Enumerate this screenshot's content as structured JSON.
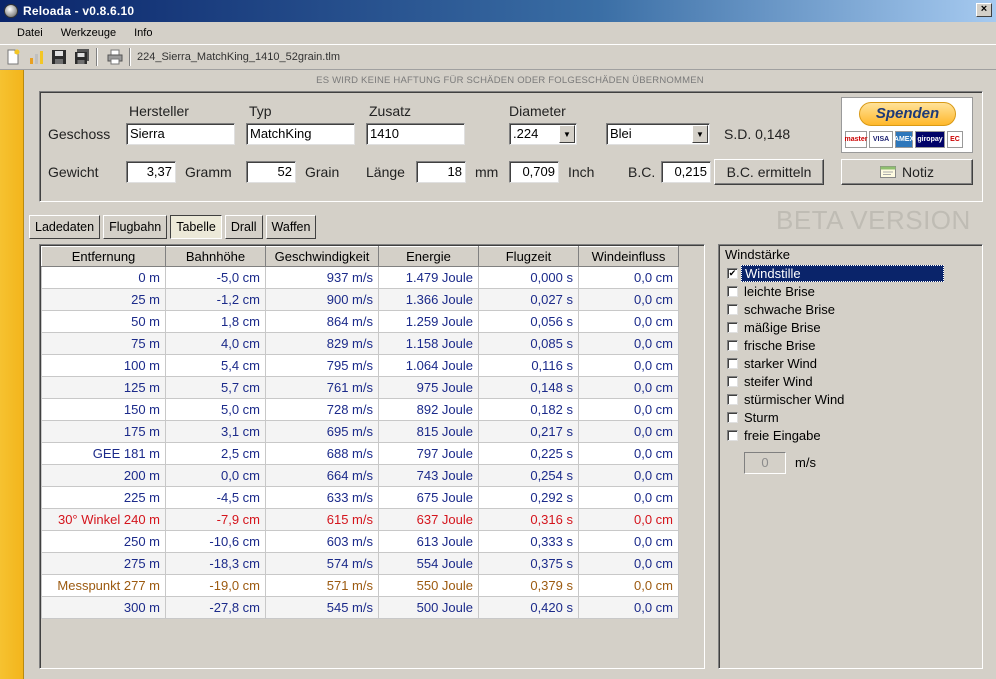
{
  "window": {
    "title": "Reloada - v0.8.6.10",
    "close_label": "×"
  },
  "menu": [
    "Datei",
    "Werkzeuge",
    "Info"
  ],
  "toolbar": {
    "buttons": [
      "new-file-icon",
      "chart-icon",
      "save-icon",
      "save-all-icon",
      "print-icon"
    ],
    "filename": "224_Sierra_MatchKing_1410_52grain.tlm"
  },
  "disclaimer": "ES WIRD KEINE HAFTUNG FÜR SCHÄDEN ODER FOLGESCHÄDEN ÜBERNOMMEN",
  "projectile": {
    "row_label": "Geschoss",
    "headers": {
      "manufacturer": "Hersteller",
      "type": "Typ",
      "suffix": "Zusatz",
      "diameter": "Diameter"
    },
    "manufacturer": "Sierra",
    "type": "MatchKing",
    "suffix": "1410",
    "diameter": ".224",
    "material": "Blei",
    "sd": "S.D. 0,148"
  },
  "weight": {
    "label": "Gewicht",
    "gramm_value": "3,37",
    "gramm_unit": "Gramm",
    "grain_value": "52",
    "grain_unit": "Grain",
    "length_label": "Länge",
    "length_value": "18",
    "length_unit": "mm",
    "inch_value": "0,709",
    "inch_unit": "Inch",
    "bc_label": "B.C.",
    "bc_value": "0,215",
    "bc_button": "B.C. ermitteln",
    "note_button": "Notiz"
  },
  "donate": {
    "label": "Spenden",
    "cards": [
      "master",
      "VISA",
      "AMEX",
      "giropay",
      "EC"
    ]
  },
  "tabs": [
    {
      "label": "Ladedaten",
      "active": false
    },
    {
      "label": "Flugbahn",
      "active": false
    },
    {
      "label": "Tabelle",
      "active": true
    },
    {
      "label": "Drall",
      "active": false
    },
    {
      "label": "Waffen",
      "active": false
    }
  ],
  "beta_label": "BETA VERSION",
  "table": {
    "columns": [
      "Entfernung",
      "Bahnhöhe",
      "Geschwindigkeit",
      "Energie",
      "Flugzeit",
      "Windeinfluss"
    ],
    "rows": [
      {
        "dist": "0 m",
        "drop": "-5,0 cm",
        "vel": "937 m/s",
        "energy": "1.479 Joule",
        "time": "0,000 s",
        "wind": "0,0 cm",
        "style": ""
      },
      {
        "dist": "25 m",
        "drop": "-1,2 cm",
        "vel": "900 m/s",
        "energy": "1.366 Joule",
        "time": "0,027 s",
        "wind": "0,0 cm",
        "style": "alt"
      },
      {
        "dist": "50 m",
        "drop": "1,8 cm",
        "vel": "864 m/s",
        "energy": "1.259 Joule",
        "time": "0,056 s",
        "wind": "0,0 cm",
        "style": ""
      },
      {
        "dist": "75 m",
        "drop": "4,0 cm",
        "vel": "829 m/s",
        "energy": "1.158 Joule",
        "time": "0,085 s",
        "wind": "0,0 cm",
        "style": "alt"
      },
      {
        "dist": "100 m",
        "drop": "5,4 cm",
        "vel": "795 m/s",
        "energy": "1.064 Joule",
        "time": "0,116 s",
        "wind": "0,0 cm",
        "style": ""
      },
      {
        "dist": "125 m",
        "drop": "5,7 cm",
        "vel": "761 m/s",
        "energy": "975 Joule",
        "time": "0,148 s",
        "wind": "0,0 cm",
        "style": "alt"
      },
      {
        "dist": "150 m",
        "drop": "5,0 cm",
        "vel": "728 m/s",
        "energy": "892 Joule",
        "time": "0,182 s",
        "wind": "0,0 cm",
        "style": ""
      },
      {
        "dist": "175 m",
        "drop": "3,1 cm",
        "vel": "695 m/s",
        "energy": "815 Joule",
        "time": "0,217 s",
        "wind": "0,0 cm",
        "style": "alt"
      },
      {
        "dist": "GEE  181 m",
        "drop": "2,5 cm",
        "vel": "688 m/s",
        "energy": "797 Joule",
        "time": "0,225 s",
        "wind": "0,0 cm",
        "style": ""
      },
      {
        "dist": "200 m",
        "drop": "0,0 cm",
        "vel": "664 m/s",
        "energy": "743 Joule",
        "time": "0,254 s",
        "wind": "0,0 cm",
        "style": "alt"
      },
      {
        "dist": "225 m",
        "drop": "-4,5 cm",
        "vel": "633 m/s",
        "energy": "675 Joule",
        "time": "0,292 s",
        "wind": "0,0 cm",
        "style": ""
      },
      {
        "dist": "30° Winkel  240 m",
        "drop": "-7,9 cm",
        "vel": "615 m/s",
        "energy": "637 Joule",
        "time": "0,316 s",
        "wind": "0,0 cm",
        "style": "alt red"
      },
      {
        "dist": "250 m",
        "drop": "-10,6 cm",
        "vel": "603 m/s",
        "energy": "613 Joule",
        "time": "0,333 s",
        "wind": "0,0 cm",
        "style": ""
      },
      {
        "dist": "275 m",
        "drop": "-18,3 cm",
        "vel": "574 m/s",
        "energy": "554 Joule",
        "time": "0,375 s",
        "wind": "0,0 cm",
        "style": "alt"
      },
      {
        "dist": "Messpunkt  277 m",
        "drop": "-19,0 cm",
        "vel": "571 m/s",
        "energy": "550 Joule",
        "time": "0,379 s",
        "wind": "0,0 cm",
        "style": "brown"
      },
      {
        "dist": "300 m",
        "drop": "-27,8 cm",
        "vel": "545 m/s",
        "energy": "500 Joule",
        "time": "0,420 s",
        "wind": "0,0 cm",
        "style": "alt"
      }
    ]
  },
  "wind": {
    "title": "Windstärke",
    "options": [
      {
        "label": "Windstille",
        "checked": true
      },
      {
        "label": "leichte Brise",
        "checked": false
      },
      {
        "label": "schwache Brise",
        "checked": false
      },
      {
        "label": "mäßige Brise",
        "checked": false
      },
      {
        "label": "frische Brise",
        "checked": false
      },
      {
        "label": "starker Wind",
        "checked": false
      },
      {
        "label": "steifer Wind",
        "checked": false
      },
      {
        "label": "stürmischer Wind",
        "checked": false
      },
      {
        "label": "Sturm",
        "checked": false
      },
      {
        "label": "freie Eingabe",
        "checked": false
      }
    ],
    "custom_value": "0",
    "unit": "m/s"
  },
  "colors": {
    "accent_strip": "#f3b51c",
    "selection": "#0a246a",
    "table_text": "#1b2a8a",
    "highlight_red": "#d4141c",
    "highlight_brown": "#9c5a10"
  }
}
